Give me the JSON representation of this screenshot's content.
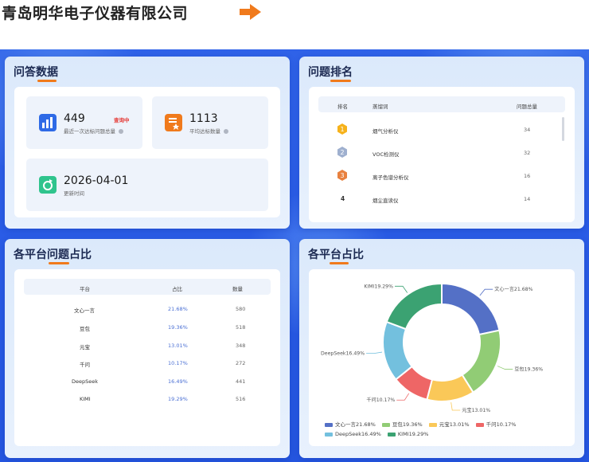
{
  "header": {
    "company": "青岛明华电子仪器有限公司"
  },
  "qa_panel": {
    "title": "问答数据",
    "stat1": {
      "value": "449",
      "label": "最近一次达标问题总量",
      "badge": "查询中"
    },
    "stat2": {
      "value": "1113",
      "label": "平均达标数量"
    },
    "stat3": {
      "value": "2026-04-01",
      "label": "更新时间"
    }
  },
  "rank_panel": {
    "title": "问题排名",
    "headers": {
      "rank": "排名",
      "keyword": "蒸馏词",
      "total": "问题总量"
    },
    "rows": [
      {
        "rank": "1",
        "keyword": "烟气分析仪",
        "total": "34"
      },
      {
        "rank": "2",
        "keyword": "VOC检测仪",
        "total": "32"
      },
      {
        "rank": "3",
        "keyword": "离子色谱分析仪",
        "total": "16"
      },
      {
        "rank": "4",
        "keyword": "烟尘直读仪",
        "total": "14"
      }
    ]
  },
  "platform_table": {
    "title": "各平台问题占比",
    "headers": {
      "platform": "平台",
      "ratio": "占比",
      "count": "数量"
    },
    "rows": [
      {
        "platform": "文心一言",
        "ratio": "21.68%",
        "count": "580"
      },
      {
        "platform": "豆包",
        "ratio": "19.36%",
        "count": "518"
      },
      {
        "platform": "元宝",
        "ratio": "13.01%",
        "count": "348"
      },
      {
        "platform": "千问",
        "ratio": "10.17%",
        "count": "272"
      },
      {
        "platform": "DeepSeek",
        "ratio": "16.49%",
        "count": "441"
      },
      {
        "platform": "KIMI",
        "ratio": "19.29%",
        "count": "516"
      }
    ]
  },
  "platform_chart": {
    "title": "各平台占比",
    "slice_labels": [
      "文心一言21.68%",
      "豆包19.36%",
      "元宝13.01%",
      "千问10.17%",
      "DeepSeek16.49%",
      "KIMI19.29%"
    ],
    "legend_labels": [
      "文心一言21.68%",
      "豆包19.36%",
      "元宝13.01%",
      "千问10.17%",
      "DeepSeek16.49%",
      "KIMI19.29%"
    ]
  },
  "chart_data": {
    "type": "pie",
    "title": "各平台占比",
    "categories": [
      "文心一言",
      "豆包",
      "元宝",
      "千问",
      "DeepSeek",
      "KIMI"
    ],
    "values": [
      21.68,
      19.36,
      13.01,
      10.17,
      16.49,
      19.29
    ],
    "colors": [
      "#5470c6",
      "#91cc75",
      "#fac858",
      "#ee6666",
      "#73c0de",
      "#3ba272"
    ],
    "donut": true,
    "legend": "bottom"
  },
  "colors": {
    "accent": "#f07a1c",
    "background": "#2a5ce6",
    "link": "#4a6fd4"
  }
}
